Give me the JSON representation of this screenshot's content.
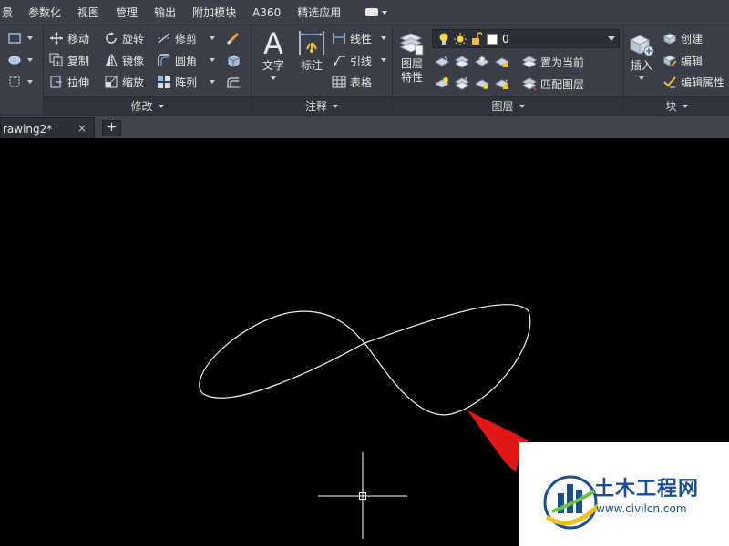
{
  "menubar": {
    "items": [
      "景",
      "参数化",
      "视图",
      "管理",
      "输出",
      "附加模块",
      "A360",
      "精选应用"
    ]
  },
  "ribbon": {
    "modify": {
      "title": "修改",
      "move": "移动",
      "rotate": "旋转",
      "trim": "修剪",
      "copy": "复制",
      "mirror": "镜像",
      "fillet": "圆角",
      "stretch": "拉伸",
      "scale": "缩放",
      "array": "阵列"
    },
    "annotation": {
      "title": "注释",
      "text": "文字",
      "dimension": "标注",
      "linear": "线性",
      "leader": "引线",
      "table": "表格"
    },
    "layers": {
      "title": "图层",
      "layer_properties_line1": "图层",
      "layer_properties_line2": "特性",
      "current_layer": "0",
      "set_current": "置为当前",
      "match_layer": "匹配图层"
    },
    "block": {
      "title": "块",
      "insert": "插入",
      "create": "创建",
      "edit": "编辑",
      "edit_attributes": "编辑属性"
    }
  },
  "tabs": {
    "document": "rawing2*",
    "close": "×",
    "new": "+"
  },
  "watermark": {
    "title": "土木工程网",
    "url": "www.civilcn.com"
  },
  "colors": {
    "ribbon_bg": "#3a3f47",
    "canvas_bg": "#000000",
    "spline": "#f2f2f2",
    "arrow": "#e21717",
    "watermark_text": "#1a4f8f"
  }
}
